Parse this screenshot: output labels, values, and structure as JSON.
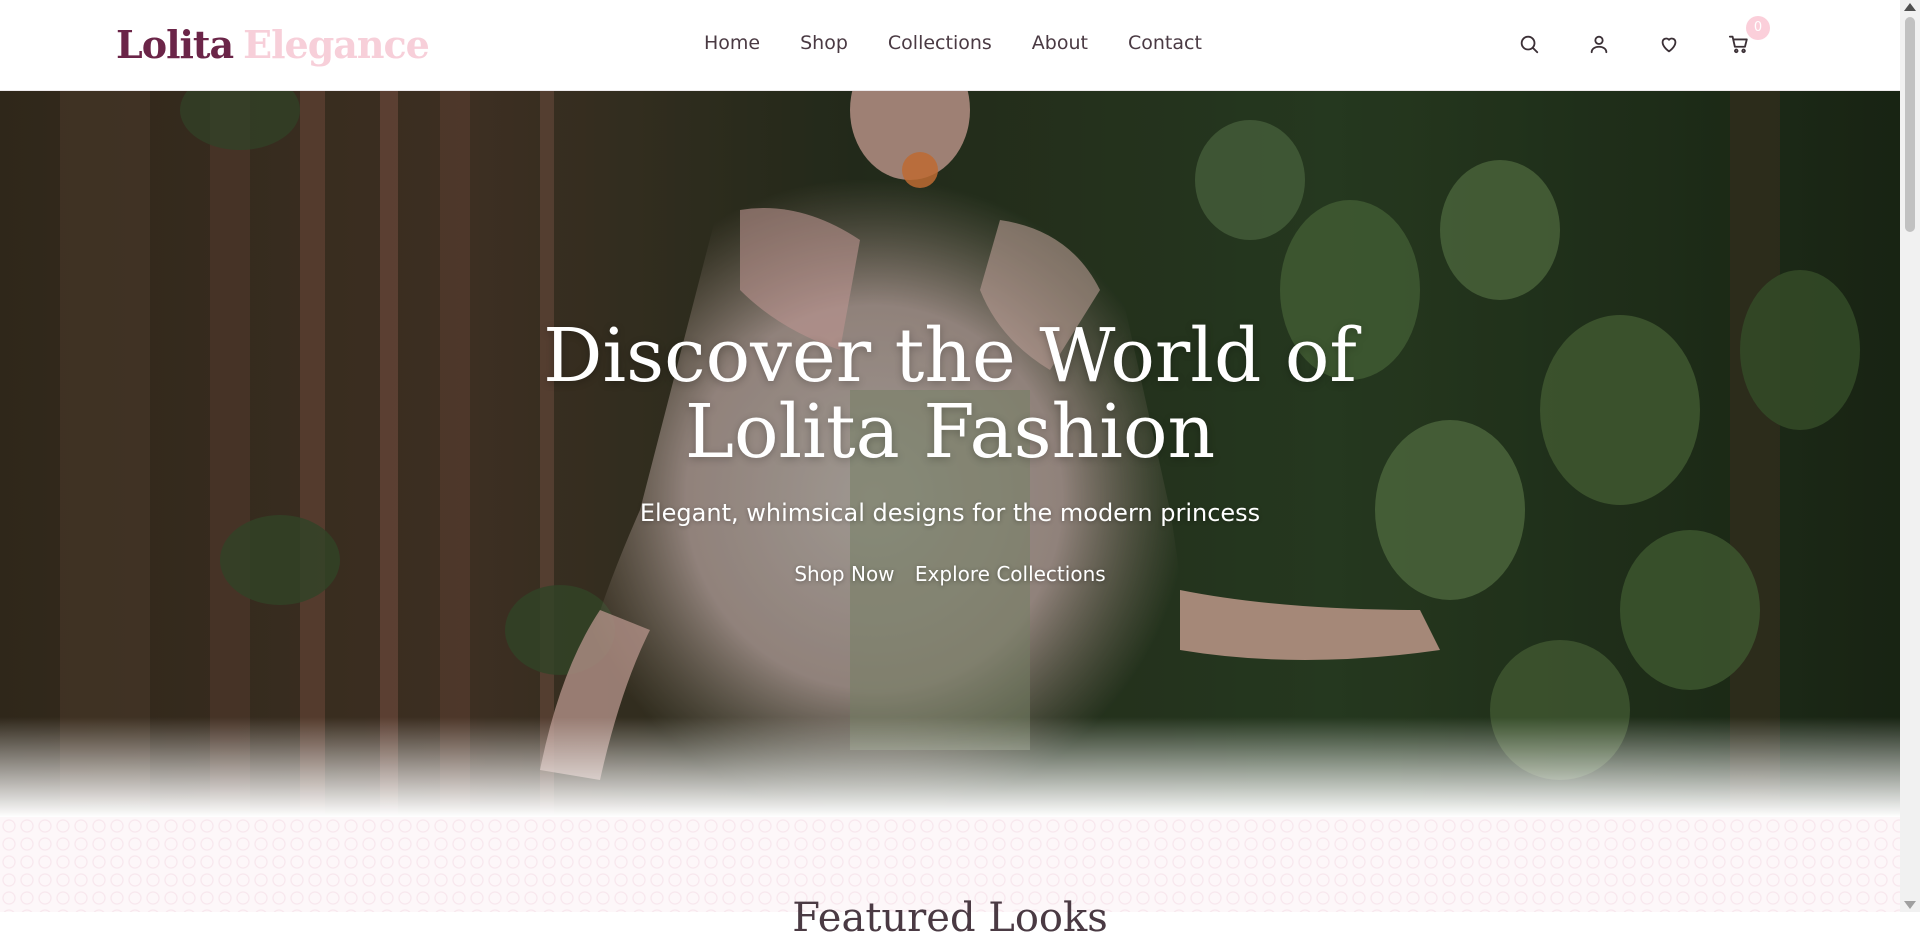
{
  "brand": {
    "name_part1": "Lolita",
    "name_part2": "Elegance"
  },
  "nav": {
    "items": [
      {
        "label": "Home"
      },
      {
        "label": "Shop"
      },
      {
        "label": "Collections"
      },
      {
        "label": "About"
      },
      {
        "label": "Contact"
      }
    ]
  },
  "header_icons": {
    "search": "search-icon",
    "account": "user-icon",
    "wishlist": "heart-icon",
    "cart": "cart-icon",
    "cart_count": "0"
  },
  "hero": {
    "title_line1": "Discover the World of",
    "title_line2": "Lolita Fashion",
    "subtitle": "Elegant, whimsical designs for the modern princess",
    "primary_cta": "Shop Now",
    "secondary_cta": "Explore Collections"
  },
  "next_section": {
    "title": "Featured Looks"
  },
  "colors": {
    "brand_dark": "#6b2548",
    "brand_pink": "#f7cfd9",
    "nav_text": "#4a3a43",
    "badge_bg": "#fbcfda"
  }
}
